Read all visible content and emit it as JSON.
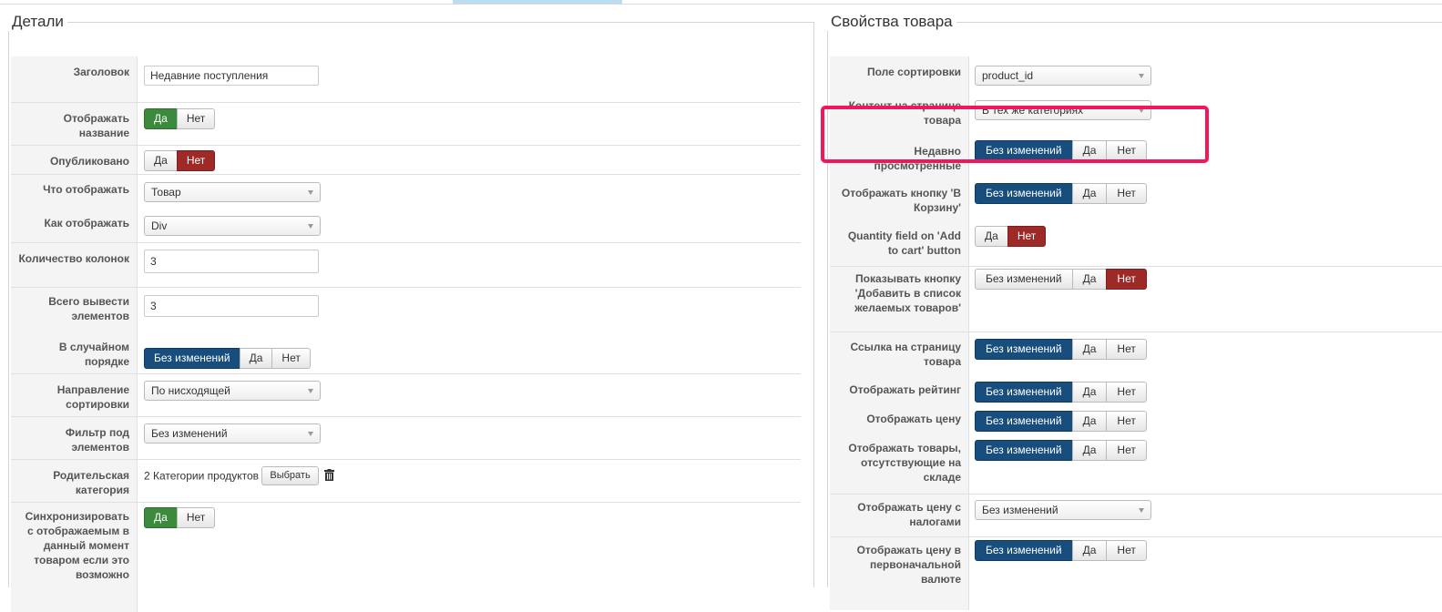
{
  "details": {
    "legend": "Детали",
    "title_label": "Заголовок",
    "title_value": "Недавние поступления",
    "show_title_label": "Отображать название",
    "published_label": "Опубликовано",
    "what_label": "Что отображать",
    "what_value": "Товар",
    "how_label": "Как отображать",
    "how_value": "Div",
    "columns_label": "Количество колонок",
    "columns_value": "3",
    "total_label": "Всего вывести элементов",
    "total_value": "3",
    "random_label": "В случайном порядке",
    "sortdir_label": "Направление сортировки",
    "sortdir_value": "По нисходящей",
    "filter_label": "Фильтр под элементов",
    "filter_value": "Без изменений",
    "parent_label": "Родительская категория",
    "parent_value": "2 Категории продуктов",
    "choose_label": "Выбрать",
    "sync_label": "Синхронизировать с отображаемым в данный момент товаром если это возможно"
  },
  "props": {
    "legend": "Свойства товара",
    "sort_field_label": "Поле сортировки",
    "sort_field_value": "product_id",
    "content_label": "Контент на странице товара",
    "content_value": "В тех же категориях",
    "recent_label": "Недавно просмотренные",
    "cart_label": "Отображать кнопку 'В Корзину'",
    "qty_label": "Quantity field on 'Add to cart' button",
    "wishlist_label": "Показывать кнопку 'Добавить в список желаемых товаров'",
    "link_label": "Ссылка на страницу товара",
    "rating_label": "Отображать рейтинг",
    "price_label": "Отображать цену",
    "outstock_label": "Отображать товары, отсутствующие на складе",
    "tax_label": "Отображать цену с налогами",
    "tax_value": "Без изменений",
    "origcur_label": "Отображать цену в первоначальной валюте"
  },
  "opts": {
    "yes": "Да",
    "no": "Нет",
    "nochange": "Без изменений"
  },
  "colors": {
    "green": "#3c8a3c",
    "red": "#9e2a27",
    "blue": "#174e7e",
    "highlight": "#f0175a"
  }
}
